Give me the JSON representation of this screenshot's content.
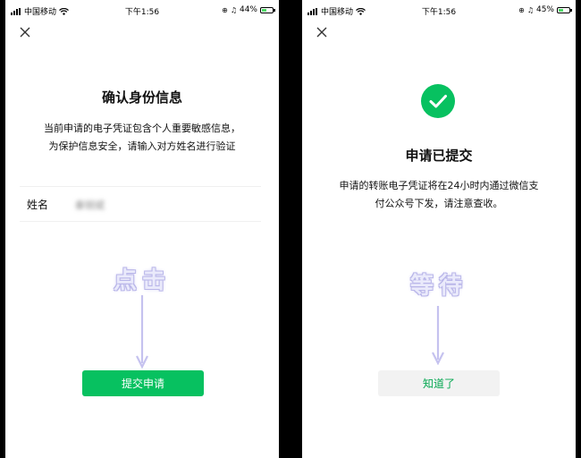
{
  "left": {
    "status": {
      "carrier": "中国移动",
      "time": "下午1:56",
      "battery": "44%",
      "battery_level": 44
    },
    "title": "确认身份信息",
    "description_line1": "当前申请的电子凭证包含个人重要敏感信息，",
    "description_line2": "为保护信息安全，请输入对方姓名进行验证",
    "name_label": "姓名",
    "name_value": "秦锐斌",
    "overlay": "点击",
    "submit_button": "提交申请"
  },
  "right": {
    "status": {
      "carrier": "中国移动",
      "time": "下午1:56",
      "battery": "45%",
      "battery_level": 45
    },
    "title": "申请已提交",
    "description_line1": "申请的转账电子凭证将在24小时内通过微信支",
    "description_line2": "付公众号下发，请注意查收。",
    "overlay": "等待",
    "ok_button": "知道了"
  },
  "colors": {
    "accent": "#07c160",
    "overlay_text": "#b9b6e9",
    "arrow": "#c5c2ef"
  }
}
